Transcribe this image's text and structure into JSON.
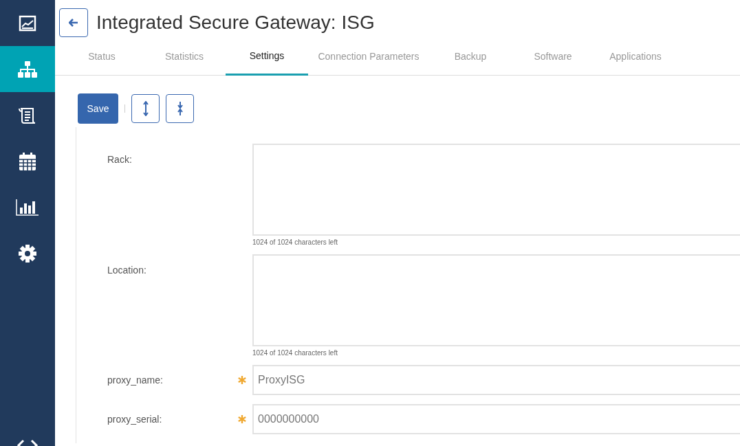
{
  "sidebar": {
    "items": [
      {
        "kind": "dashboard",
        "selected": false
      },
      {
        "kind": "network",
        "selected": true
      },
      {
        "kind": "scroll",
        "selected": false
      },
      {
        "kind": "calendar",
        "selected": false
      },
      {
        "kind": "chart",
        "selected": false
      },
      {
        "kind": "gear",
        "selected": false
      }
    ]
  },
  "header": {
    "title": "Integrated Secure Gateway: ISG"
  },
  "tabs": [
    {
      "label": "Status",
      "selected": false
    },
    {
      "label": "Statistics",
      "selected": false
    },
    {
      "label": "Settings",
      "selected": true
    },
    {
      "label": "Connection Parameters",
      "selected": false
    },
    {
      "label": "Backup",
      "selected": false
    },
    {
      "label": "Software",
      "selected": false
    },
    {
      "label": "Applications",
      "selected": false
    }
  ],
  "toolbar": {
    "save": "Save"
  },
  "fields": [
    {
      "kind": "textarea",
      "label": "Rack:",
      "required": false,
      "counter": "1024 of 1024 characters left"
    },
    {
      "kind": "textarea",
      "label": "Location:",
      "required": false,
      "counter": "1024 of 1024 characters left"
    },
    {
      "kind": "text",
      "label": "proxy_name:",
      "required": true,
      "value": "ProxyISG"
    },
    {
      "kind": "text",
      "label": "proxy_serial:",
      "required": true,
      "value": "0000000000"
    }
  ]
}
